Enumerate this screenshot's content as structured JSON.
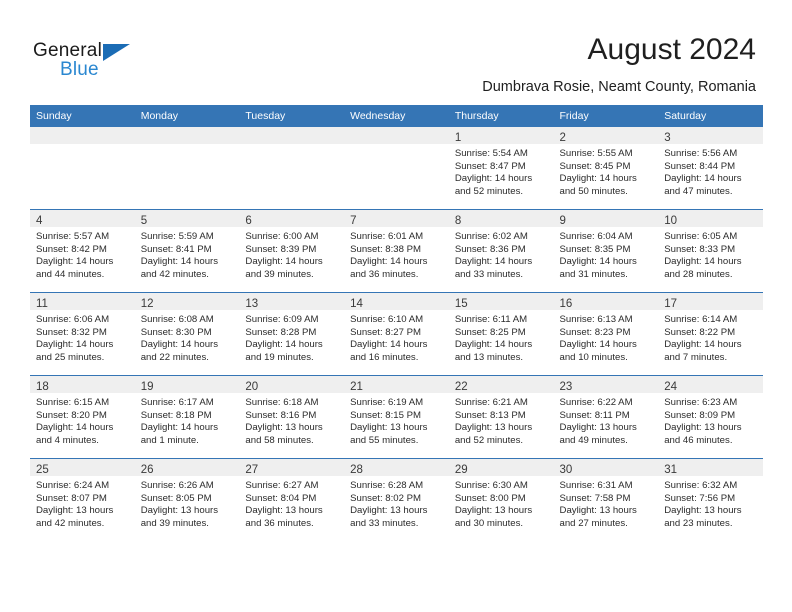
{
  "logo": {
    "word_one": "General",
    "word_two": "Blue",
    "triangle_color": "#1b6cb5",
    "word_two_color": "#2a87d0"
  },
  "header": {
    "month_title": "August 2024",
    "location": "Dumbrava Rosie, Neamt County, Romania"
  },
  "theme": {
    "header_blue": "#3575b5",
    "daynum_band": "#efefef",
    "text": "#2b2b2b"
  },
  "weekday_headers": [
    "Sunday",
    "Monday",
    "Tuesday",
    "Wednesday",
    "Thursday",
    "Friday",
    "Saturday"
  ],
  "weeks": [
    [
      {
        "day": "",
        "lines": []
      },
      {
        "day": "",
        "lines": []
      },
      {
        "day": "",
        "lines": []
      },
      {
        "day": "",
        "lines": []
      },
      {
        "day": "1",
        "lines": [
          "Sunrise: 5:54 AM",
          "Sunset: 8:47 PM",
          "Daylight: 14 hours",
          "and 52 minutes."
        ]
      },
      {
        "day": "2",
        "lines": [
          "Sunrise: 5:55 AM",
          "Sunset: 8:45 PM",
          "Daylight: 14 hours",
          "and 50 minutes."
        ]
      },
      {
        "day": "3",
        "lines": [
          "Sunrise: 5:56 AM",
          "Sunset: 8:44 PM",
          "Daylight: 14 hours",
          "and 47 minutes."
        ]
      }
    ],
    [
      {
        "day": "4",
        "lines": [
          "Sunrise: 5:57 AM",
          "Sunset: 8:42 PM",
          "Daylight: 14 hours",
          "and 44 minutes."
        ]
      },
      {
        "day": "5",
        "lines": [
          "Sunrise: 5:59 AM",
          "Sunset: 8:41 PM",
          "Daylight: 14 hours",
          "and 42 minutes."
        ]
      },
      {
        "day": "6",
        "lines": [
          "Sunrise: 6:00 AM",
          "Sunset: 8:39 PM",
          "Daylight: 14 hours",
          "and 39 minutes."
        ]
      },
      {
        "day": "7",
        "lines": [
          "Sunrise: 6:01 AM",
          "Sunset: 8:38 PM",
          "Daylight: 14 hours",
          "and 36 minutes."
        ]
      },
      {
        "day": "8",
        "lines": [
          "Sunrise: 6:02 AM",
          "Sunset: 8:36 PM",
          "Daylight: 14 hours",
          "and 33 minutes."
        ]
      },
      {
        "day": "9",
        "lines": [
          "Sunrise: 6:04 AM",
          "Sunset: 8:35 PM",
          "Daylight: 14 hours",
          "and 31 minutes."
        ]
      },
      {
        "day": "10",
        "lines": [
          "Sunrise: 6:05 AM",
          "Sunset: 8:33 PM",
          "Daylight: 14 hours",
          "and 28 minutes."
        ]
      }
    ],
    [
      {
        "day": "11",
        "lines": [
          "Sunrise: 6:06 AM",
          "Sunset: 8:32 PM",
          "Daylight: 14 hours",
          "and 25 minutes."
        ]
      },
      {
        "day": "12",
        "lines": [
          "Sunrise: 6:08 AM",
          "Sunset: 8:30 PM",
          "Daylight: 14 hours",
          "and 22 minutes."
        ]
      },
      {
        "day": "13",
        "lines": [
          "Sunrise: 6:09 AM",
          "Sunset: 8:28 PM",
          "Daylight: 14 hours",
          "and 19 minutes."
        ]
      },
      {
        "day": "14",
        "lines": [
          "Sunrise: 6:10 AM",
          "Sunset: 8:27 PM",
          "Daylight: 14 hours",
          "and 16 minutes."
        ]
      },
      {
        "day": "15",
        "lines": [
          "Sunrise: 6:11 AM",
          "Sunset: 8:25 PM",
          "Daylight: 14 hours",
          "and 13 minutes."
        ]
      },
      {
        "day": "16",
        "lines": [
          "Sunrise: 6:13 AM",
          "Sunset: 8:23 PM",
          "Daylight: 14 hours",
          "and 10 minutes."
        ]
      },
      {
        "day": "17",
        "lines": [
          "Sunrise: 6:14 AM",
          "Sunset: 8:22 PM",
          "Daylight: 14 hours",
          "and 7 minutes."
        ]
      }
    ],
    [
      {
        "day": "18",
        "lines": [
          "Sunrise: 6:15 AM",
          "Sunset: 8:20 PM",
          "Daylight: 14 hours",
          "and 4 minutes."
        ]
      },
      {
        "day": "19",
        "lines": [
          "Sunrise: 6:17 AM",
          "Sunset: 8:18 PM",
          "Daylight: 14 hours",
          "and 1 minute."
        ]
      },
      {
        "day": "20",
        "lines": [
          "Sunrise: 6:18 AM",
          "Sunset: 8:16 PM",
          "Daylight: 13 hours",
          "and 58 minutes."
        ]
      },
      {
        "day": "21",
        "lines": [
          "Sunrise: 6:19 AM",
          "Sunset: 8:15 PM",
          "Daylight: 13 hours",
          "and 55 minutes."
        ]
      },
      {
        "day": "22",
        "lines": [
          "Sunrise: 6:21 AM",
          "Sunset: 8:13 PM",
          "Daylight: 13 hours",
          "and 52 minutes."
        ]
      },
      {
        "day": "23",
        "lines": [
          "Sunrise: 6:22 AM",
          "Sunset: 8:11 PM",
          "Daylight: 13 hours",
          "and 49 minutes."
        ]
      },
      {
        "day": "24",
        "lines": [
          "Sunrise: 6:23 AM",
          "Sunset: 8:09 PM",
          "Daylight: 13 hours",
          "and 46 minutes."
        ]
      }
    ],
    [
      {
        "day": "25",
        "lines": [
          "Sunrise: 6:24 AM",
          "Sunset: 8:07 PM",
          "Daylight: 13 hours",
          "and 42 minutes."
        ]
      },
      {
        "day": "26",
        "lines": [
          "Sunrise: 6:26 AM",
          "Sunset: 8:05 PM",
          "Daylight: 13 hours",
          "and 39 minutes."
        ]
      },
      {
        "day": "27",
        "lines": [
          "Sunrise: 6:27 AM",
          "Sunset: 8:04 PM",
          "Daylight: 13 hours",
          "and 36 minutes."
        ]
      },
      {
        "day": "28",
        "lines": [
          "Sunrise: 6:28 AM",
          "Sunset: 8:02 PM",
          "Daylight: 13 hours",
          "and 33 minutes."
        ]
      },
      {
        "day": "29",
        "lines": [
          "Sunrise: 6:30 AM",
          "Sunset: 8:00 PM",
          "Daylight: 13 hours",
          "and 30 minutes."
        ]
      },
      {
        "day": "30",
        "lines": [
          "Sunrise: 6:31 AM",
          "Sunset: 7:58 PM",
          "Daylight: 13 hours",
          "and 27 minutes."
        ]
      },
      {
        "day": "31",
        "lines": [
          "Sunrise: 6:32 AM",
          "Sunset: 7:56 PM",
          "Daylight: 13 hours",
          "and 23 minutes."
        ]
      }
    ]
  ]
}
